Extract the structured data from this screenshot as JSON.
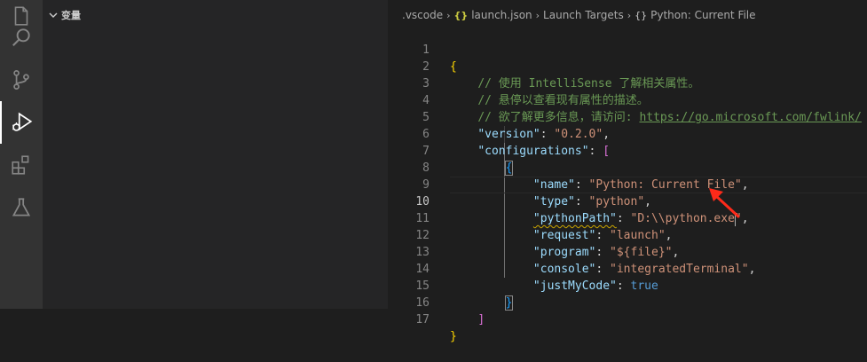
{
  "sidebar": {
    "section_title": "变量"
  },
  "breadcrumb": {
    "folder": ".vscode",
    "file": "launch.json",
    "file_icon": "{}",
    "item1": "Launch Targets",
    "item2_icon": "{}",
    "item2": "Python: Current File"
  },
  "code": {
    "line_numbers": [
      "1",
      "2",
      "3",
      "4",
      "5",
      "6",
      "7",
      "8",
      "9",
      "10",
      "11",
      "12",
      "13",
      "14",
      "15",
      "16",
      "17"
    ],
    "current_line": "10",
    "comment1": "// 使用 IntelliSense 了解相关属性。",
    "comment2": "// 悬停以查看现有属性的描述。",
    "comment3_text": "// 欲了解更多信息，请访问: ",
    "comment3_link": "https://go.microsoft.com/fwlink/",
    "version_key": "\"version\"",
    "version_val": "\"0.2.0\"",
    "configs_key": "\"configurations\"",
    "name_key": "\"name\"",
    "name_val": "\"Python: Current File\"",
    "type_key": "\"type\"",
    "type_val": "\"python\"",
    "pythonpath_key": "\"pythonPath\"",
    "pythonpath_val_a": "\"D:\\\\python.exe",
    "pythonpath_val_b": "\"",
    "request_key": "\"request\"",
    "request_val": "\"launch\"",
    "program_key": "\"program\"",
    "program_val": "\"${file}\"",
    "console_key": "\"console\"",
    "console_val": "\"integratedTerminal\"",
    "justmycode_key": "\"justMyCode\"",
    "justmycode_val": "true"
  },
  "colors": {
    "arrow": "#ff2a1a",
    "accent": "#007acc"
  }
}
